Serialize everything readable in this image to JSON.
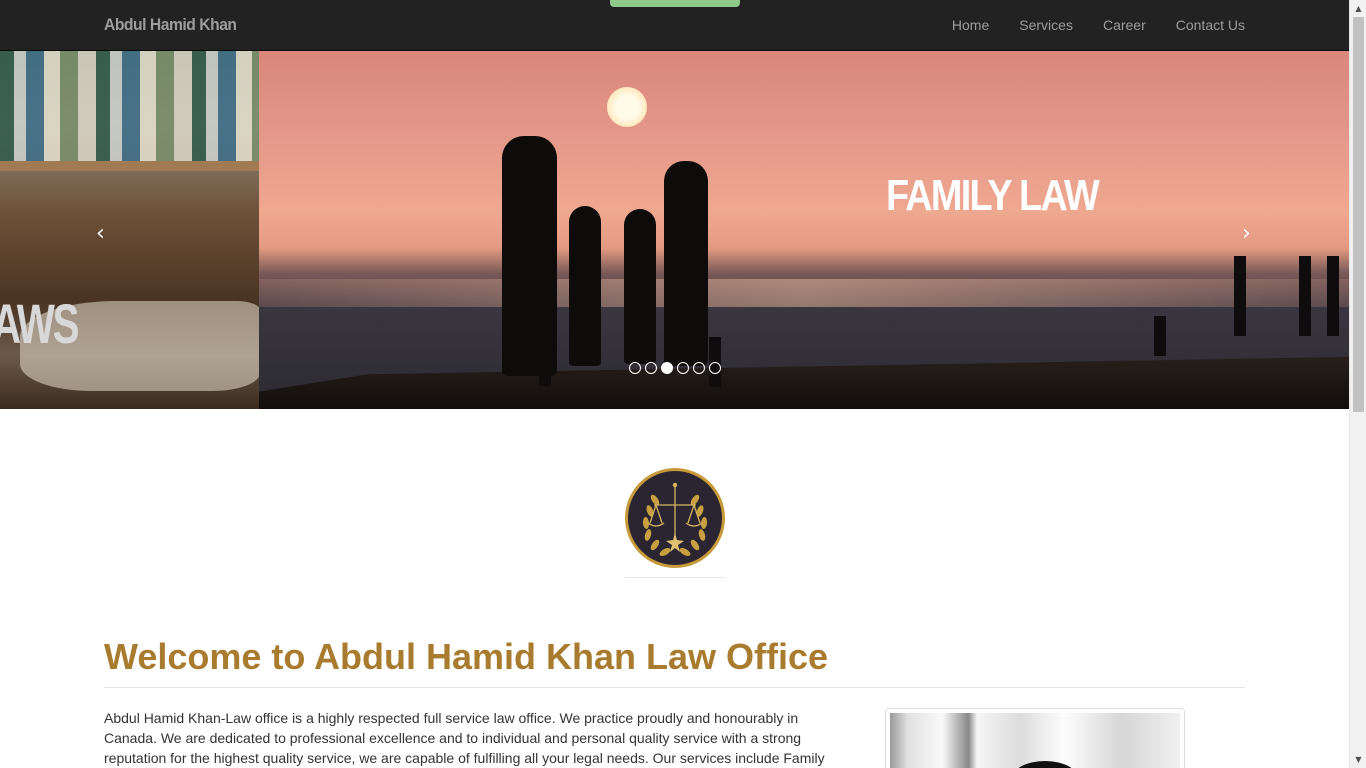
{
  "navbar": {
    "brand": "Abdul Hamid Khan",
    "items": [
      {
        "label": "Home"
      },
      {
        "label": "Services"
      },
      {
        "label": "Career"
      },
      {
        "label": "Contact Us"
      }
    ]
  },
  "carousel": {
    "left_slide_text": "AWS",
    "current_slide_title": "FAMILY LAW",
    "prev_icon": "‹",
    "next_icon": "›",
    "slide_count": 6,
    "active_index": 2
  },
  "logo": {
    "icon": "scales-of-justice-icon"
  },
  "welcome": {
    "title": "Welcome to Abdul Hamid Khan Law Office",
    "intro": "Abdul Hamid Khan-Law office is a highly respected full service law office. We practice proudly and honourably in Canada. We are dedicated to professional excellence and to individual and personal quality service with a strong reputation for the highest quality service, we are capable of fulfilling all your legal needs. Our services include Family"
  },
  "colors": {
    "navbar_bg": "#222222",
    "nav_text": "#9d9d9d",
    "heading_gold": "#a87b2f",
    "accent_green": "#8fc98a"
  }
}
